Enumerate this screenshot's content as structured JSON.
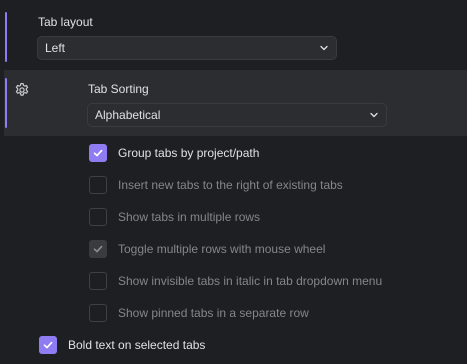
{
  "tab_layout": {
    "label": "Tab layout",
    "value": "Left"
  },
  "tab_sorting": {
    "icon": "gear-icon",
    "label": "Tab Sorting",
    "value": "Alphabetical"
  },
  "options": [
    {
      "label": "Group tabs by project/path",
      "checked": true,
      "enabled": true
    },
    {
      "label": "Insert new tabs to the right of existing tabs",
      "checked": false,
      "enabled": false
    },
    {
      "label": "Show tabs in multiple rows",
      "checked": false,
      "enabled": false
    },
    {
      "label": "Toggle multiple rows with mouse wheel",
      "checked": true,
      "enabled": false
    },
    {
      "label": "Show invisible tabs in italic in tab dropdown menu",
      "checked": false,
      "enabled": false
    },
    {
      "label": "Show pinned tabs in a separate row",
      "checked": false,
      "enabled": false
    }
  ],
  "bold_selected": {
    "label": "Bold text on selected tabs",
    "checked": true
  },
  "colors": {
    "accent": "#8f7cf3",
    "background": "#1e1f22",
    "section_background": "#2b2d30"
  }
}
